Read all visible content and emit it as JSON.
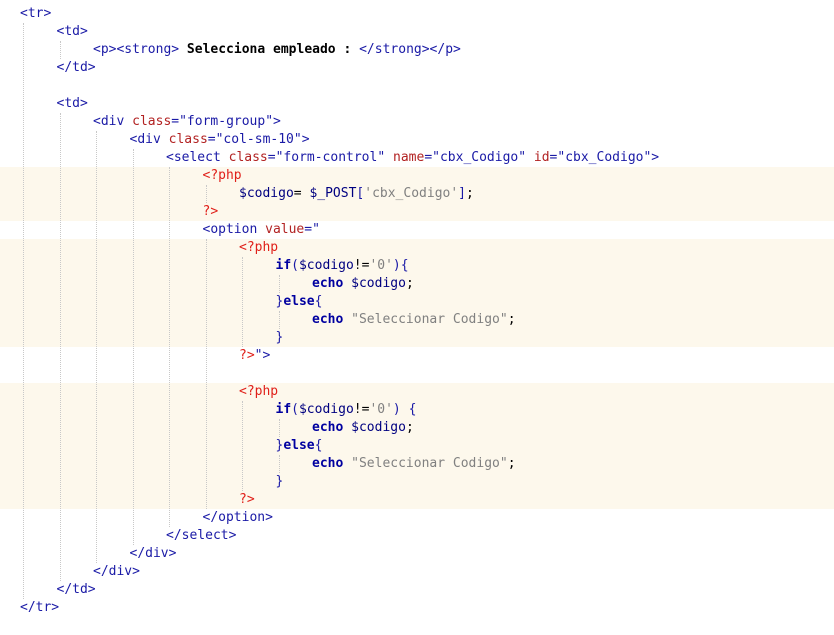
{
  "editor": {
    "colors": {
      "background": "#ffffff",
      "php_block_background": "#fdf8ec",
      "indent_guide": "#c8c8c8",
      "tag": "#1a1aa6",
      "attribute": "#b22222",
      "attribute_value": "#1a1aa6",
      "bold_text": "#000000",
      "php_delimiter": "#e0201a",
      "keyword": "#0000a0",
      "variable": "#000080",
      "php_string": "#808080"
    },
    "lines": [
      {
        "indent": 0,
        "php_bg": false,
        "tokens": [
          {
            "t": "tag",
            "v": "<tr>"
          }
        ]
      },
      {
        "indent": 1,
        "php_bg": false,
        "tokens": [
          {
            "t": "tag",
            "v": "<td>"
          }
        ]
      },
      {
        "indent": 2,
        "php_bg": false,
        "tokens": [
          {
            "t": "tag",
            "v": "<p><strong>"
          },
          {
            "t": "text",
            "v": " Selecciona empleado : "
          },
          {
            "t": "tag",
            "v": "</strong></p>"
          }
        ]
      },
      {
        "indent": 1,
        "php_bg": false,
        "tokens": [
          {
            "t": "tag",
            "v": "</td>"
          }
        ]
      },
      {
        "indent": 0,
        "php_bg": false,
        "tokens": []
      },
      {
        "indent": 1,
        "php_bg": false,
        "tokens": [
          {
            "t": "tag",
            "v": "<td>"
          }
        ]
      },
      {
        "indent": 2,
        "php_bg": false,
        "tokens": [
          {
            "t": "tag",
            "v": "<div "
          },
          {
            "t": "attr",
            "v": "class"
          },
          {
            "t": "tag",
            "v": "="
          },
          {
            "t": "str",
            "v": "\"form-group\""
          },
          {
            "t": "tag",
            "v": ">"
          }
        ]
      },
      {
        "indent": 3,
        "php_bg": false,
        "tokens": [
          {
            "t": "tag",
            "v": "<div "
          },
          {
            "t": "attr",
            "v": "class"
          },
          {
            "t": "tag",
            "v": "="
          },
          {
            "t": "str",
            "v": "\"col-sm-10\""
          },
          {
            "t": "tag",
            "v": ">"
          }
        ]
      },
      {
        "indent": 4,
        "php_bg": false,
        "tokens": [
          {
            "t": "tag",
            "v": "<select "
          },
          {
            "t": "attr",
            "v": "class"
          },
          {
            "t": "tag",
            "v": "="
          },
          {
            "t": "str",
            "v": "\"form-control\""
          },
          {
            "t": "tag",
            "v": " "
          },
          {
            "t": "attr",
            "v": "name"
          },
          {
            "t": "tag",
            "v": "="
          },
          {
            "t": "str",
            "v": "\"cbx_Codigo\""
          },
          {
            "t": "tag",
            "v": " "
          },
          {
            "t": "attr",
            "v": "id"
          },
          {
            "t": "tag",
            "v": "="
          },
          {
            "t": "str",
            "v": "\"cbx_Codigo\""
          },
          {
            "t": "tag",
            "v": ">"
          }
        ]
      },
      {
        "indent": 5,
        "php_bg": true,
        "tokens": [
          {
            "t": "php",
            "v": "<?php"
          }
        ]
      },
      {
        "indent": 6,
        "php_bg": true,
        "tokens": [
          {
            "t": "var",
            "v": "$codigo"
          },
          {
            "t": "plain",
            "v": "= "
          },
          {
            "t": "var",
            "v": "$_POST"
          },
          {
            "t": "punct",
            "v": "["
          },
          {
            "t": "phpstr",
            "v": "'cbx_Codigo'"
          },
          {
            "t": "punct",
            "v": "]"
          },
          {
            "t": "plain",
            "v": ";"
          }
        ]
      },
      {
        "indent": 5,
        "php_bg": true,
        "tokens": [
          {
            "t": "php",
            "v": "?>"
          }
        ]
      },
      {
        "indent": 5,
        "php_bg": false,
        "tokens": [
          {
            "t": "tag",
            "v": "<option "
          },
          {
            "t": "attr",
            "v": "value"
          },
          {
            "t": "tag",
            "v": "="
          },
          {
            "t": "str",
            "v": "\""
          }
        ]
      },
      {
        "indent": 6,
        "php_bg": true,
        "tokens": [
          {
            "t": "php",
            "v": "<?php"
          }
        ]
      },
      {
        "indent": 7,
        "php_bg": true,
        "tokens": [
          {
            "t": "kw",
            "v": "if"
          },
          {
            "t": "punct",
            "v": "("
          },
          {
            "t": "var",
            "v": "$codigo"
          },
          {
            "t": "plain",
            "v": "!="
          },
          {
            "t": "phpstr",
            "v": "'0'"
          },
          {
            "t": "punct",
            "v": "){"
          }
        ]
      },
      {
        "indent": 8,
        "php_bg": true,
        "tokens": [
          {
            "t": "kw",
            "v": "echo"
          },
          {
            "t": "plain",
            "v": " "
          },
          {
            "t": "var",
            "v": "$codigo"
          },
          {
            "t": "plain",
            "v": ";"
          }
        ]
      },
      {
        "indent": 7,
        "php_bg": true,
        "tokens": [
          {
            "t": "punct",
            "v": "}"
          },
          {
            "t": "kw",
            "v": "else"
          },
          {
            "t": "punct",
            "v": "{"
          }
        ]
      },
      {
        "indent": 8,
        "php_bg": true,
        "tokens": [
          {
            "t": "kw",
            "v": "echo"
          },
          {
            "t": "plain",
            "v": " "
          },
          {
            "t": "phpstr",
            "v": "\"Seleccionar Codigo\""
          },
          {
            "t": "plain",
            "v": ";"
          }
        ]
      },
      {
        "indent": 7,
        "php_bg": true,
        "tokens": [
          {
            "t": "punct",
            "v": "}"
          }
        ]
      },
      {
        "indent": 6,
        "php_bg": false,
        "tokens": [
          {
            "t": "php",
            "v": "?>"
          },
          {
            "t": "str",
            "v": "\">"
          }
        ]
      },
      {
        "indent": 6,
        "php_bg": false,
        "tokens": []
      },
      {
        "indent": 6,
        "php_bg": true,
        "tokens": [
          {
            "t": "php",
            "v": "<?php"
          }
        ]
      },
      {
        "indent": 7,
        "php_bg": true,
        "tokens": [
          {
            "t": "kw",
            "v": "if"
          },
          {
            "t": "punct",
            "v": "("
          },
          {
            "t": "var",
            "v": "$codigo"
          },
          {
            "t": "plain",
            "v": "!="
          },
          {
            "t": "phpstr",
            "v": "'0'"
          },
          {
            "t": "punct",
            "v": ") {"
          }
        ]
      },
      {
        "indent": 8,
        "php_bg": true,
        "tokens": [
          {
            "t": "kw",
            "v": "echo"
          },
          {
            "t": "plain",
            "v": " "
          },
          {
            "t": "var",
            "v": "$codigo"
          },
          {
            "t": "plain",
            "v": ";"
          }
        ]
      },
      {
        "indent": 7,
        "php_bg": true,
        "tokens": [
          {
            "t": "punct",
            "v": "}"
          },
          {
            "t": "kw",
            "v": "else"
          },
          {
            "t": "punct",
            "v": "{"
          }
        ]
      },
      {
        "indent": 8,
        "php_bg": true,
        "tokens": [
          {
            "t": "kw",
            "v": "echo"
          },
          {
            "t": "plain",
            "v": " "
          },
          {
            "t": "phpstr",
            "v": "\"Seleccionar Codigo\""
          },
          {
            "t": "plain",
            "v": ";"
          }
        ]
      },
      {
        "indent": 7,
        "php_bg": true,
        "tokens": [
          {
            "t": "punct",
            "v": "}"
          }
        ]
      },
      {
        "indent": 6,
        "php_bg": true,
        "tokens": [
          {
            "t": "php",
            "v": "?>"
          }
        ]
      },
      {
        "indent": 5,
        "php_bg": false,
        "tokens": [
          {
            "t": "tag",
            "v": "</option>"
          }
        ]
      },
      {
        "indent": 4,
        "php_bg": false,
        "tokens": [
          {
            "t": "tag",
            "v": "</select>"
          }
        ]
      },
      {
        "indent": 3,
        "php_bg": false,
        "tokens": [
          {
            "t": "tag",
            "v": "</div>"
          }
        ]
      },
      {
        "indent": 2,
        "php_bg": false,
        "tokens": [
          {
            "t": "tag",
            "v": "</div>"
          }
        ]
      },
      {
        "indent": 1,
        "php_bg": false,
        "tokens": [
          {
            "t": "tag",
            "v": "</td>"
          }
        ]
      },
      {
        "indent": 0,
        "php_bg": false,
        "tokens": [
          {
            "t": "tag",
            "v": "</tr>"
          }
        ]
      },
      {
        "indent": 0,
        "php_bg": false,
        "tokens": []
      }
    ]
  }
}
